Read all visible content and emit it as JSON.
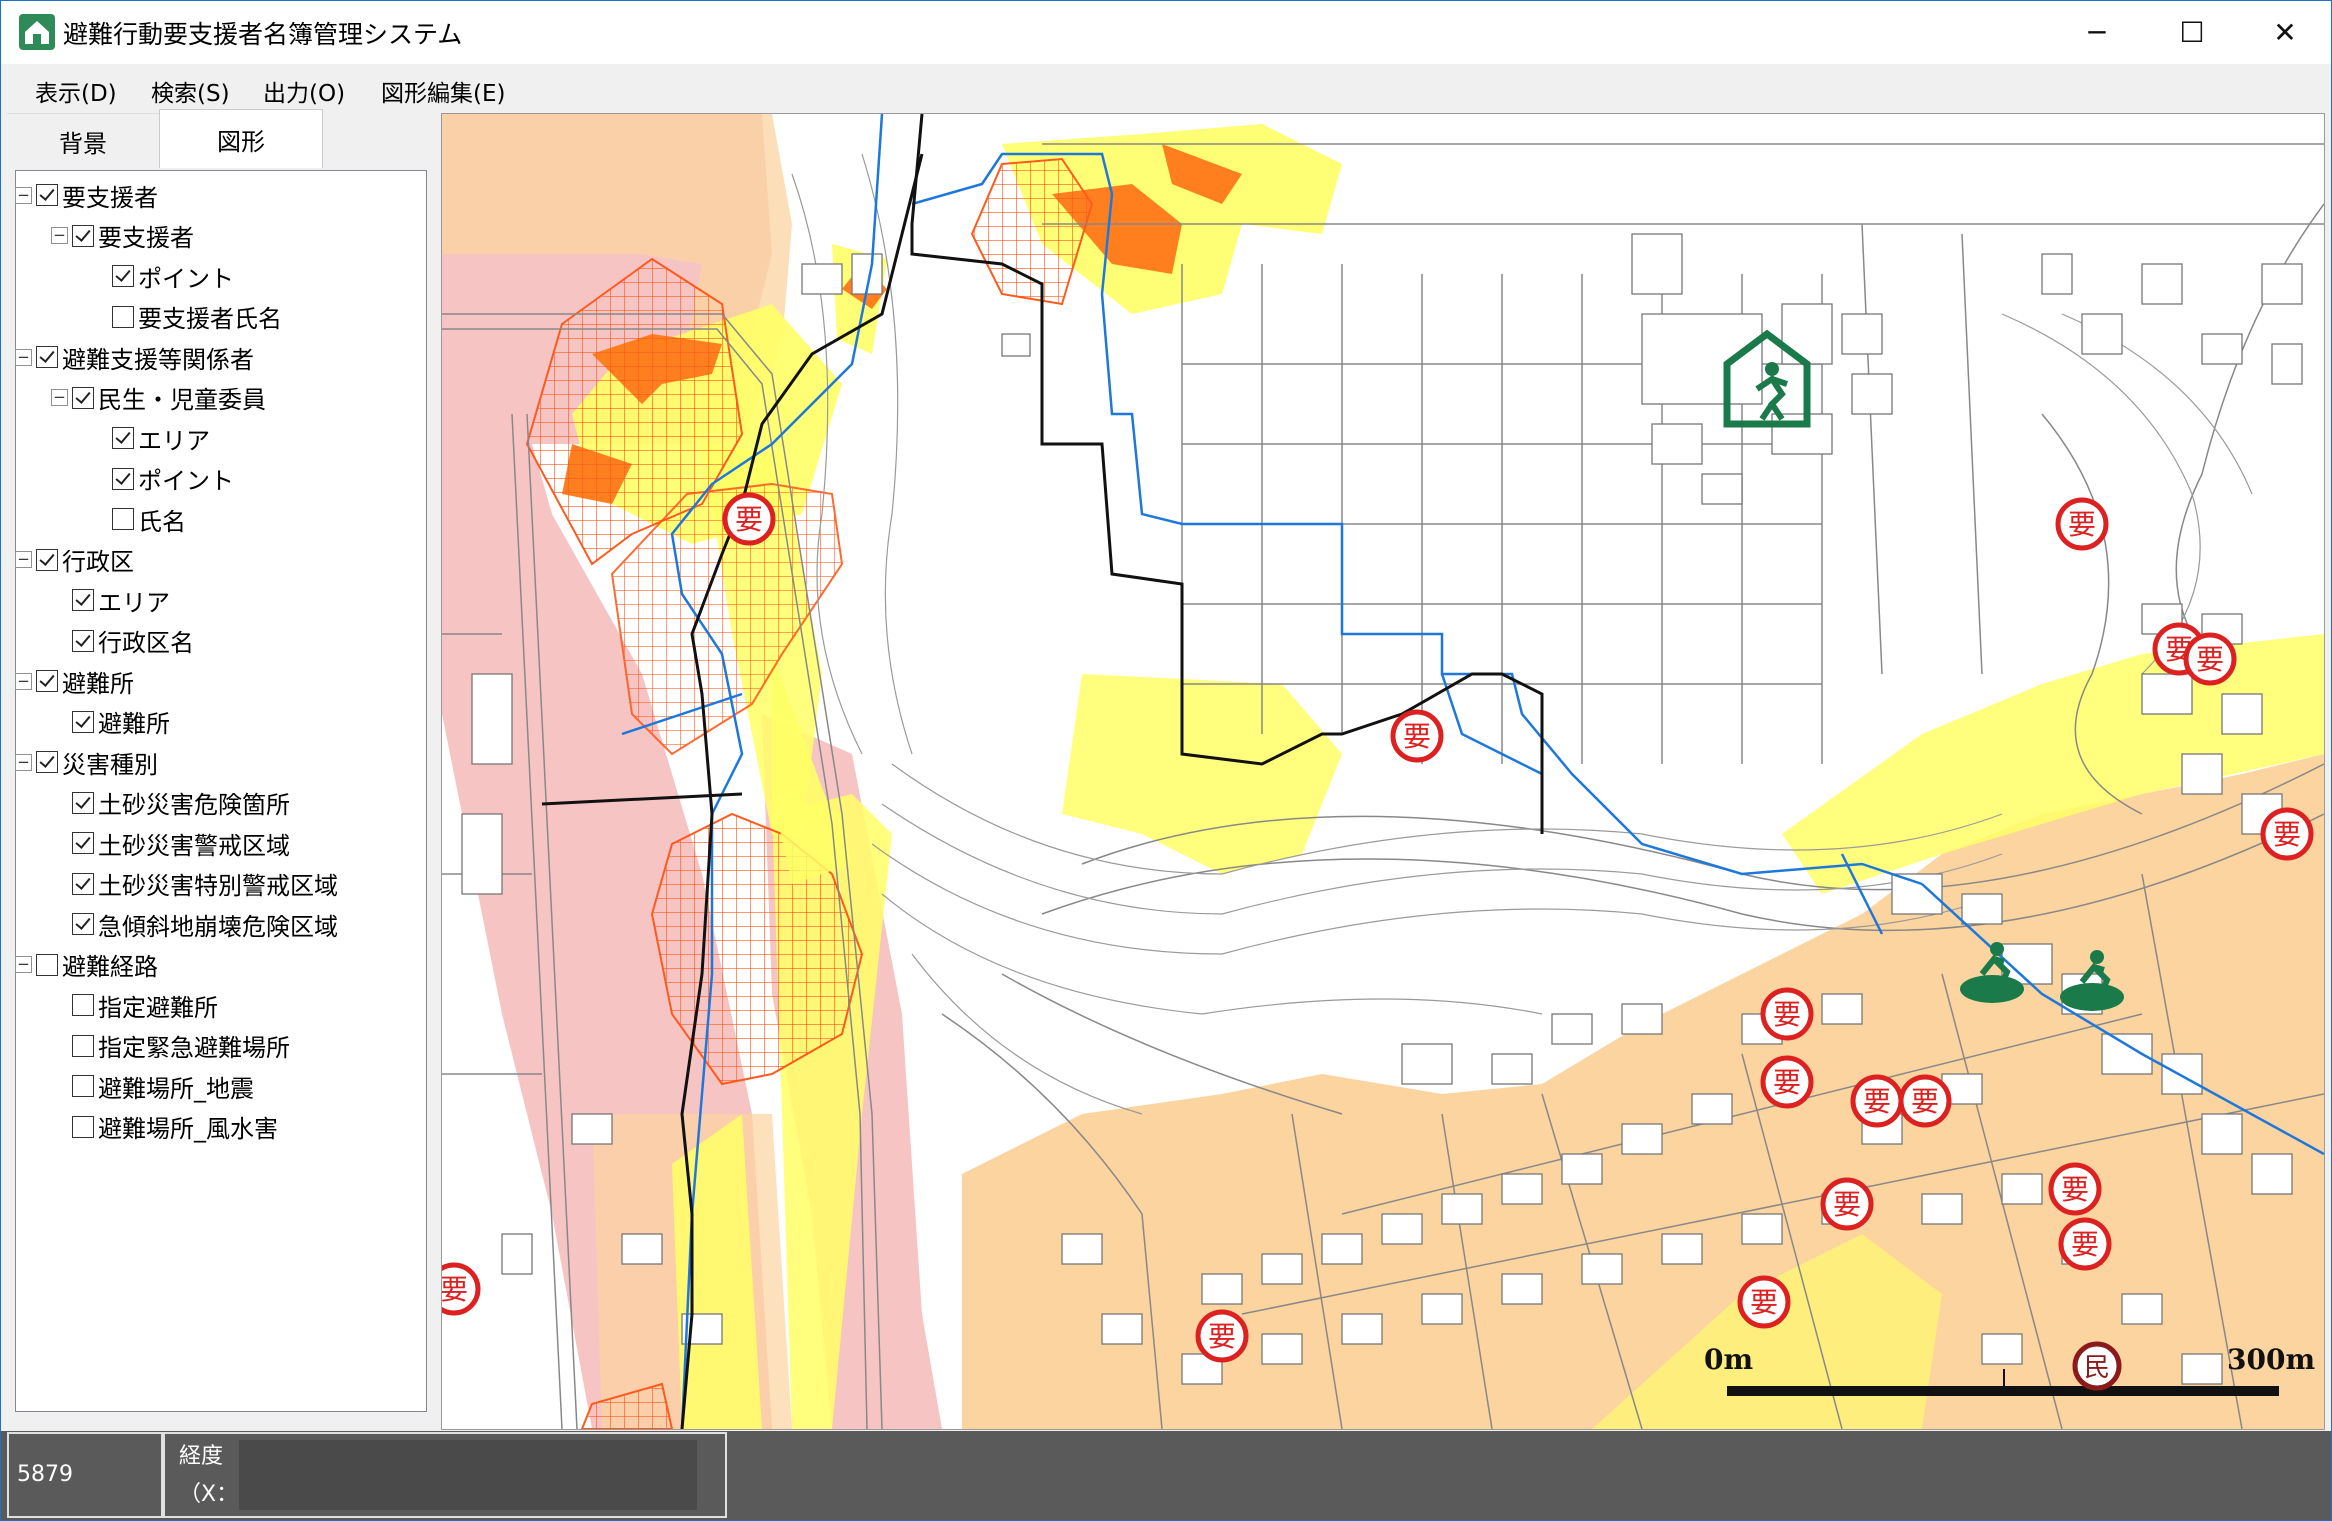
{
  "window": {
    "title": "避難行動要支援者名簿管理システム",
    "minimize_glyph": "─",
    "maximize_glyph": "☐",
    "close_glyph": "✕"
  },
  "menu": [
    {
      "label": "表示(D)"
    },
    {
      "label": "検索(S)"
    },
    {
      "label": "出力(O)"
    },
    {
      "label": "図形編集(E)"
    }
  ],
  "tabs": [
    {
      "label": "背景",
      "active": false
    },
    {
      "label": "図形",
      "active": true
    }
  ],
  "layer_tree": [
    {
      "label": "要支援者",
      "level": 0,
      "checked": true,
      "expander": "−"
    },
    {
      "label": "要支援者",
      "level": 1,
      "checked": true,
      "expander": "−"
    },
    {
      "label": "ポイント",
      "level": 2,
      "checked": true
    },
    {
      "label": "要支援者氏名",
      "level": 2,
      "checked": false
    },
    {
      "label": "避難支援等関係者",
      "level": 0,
      "checked": true,
      "expander": "−"
    },
    {
      "label": "民生・児童委員",
      "level": 1,
      "checked": true,
      "expander": "−"
    },
    {
      "label": "エリア",
      "level": 2,
      "checked": true
    },
    {
      "label": "ポイント",
      "level": 2,
      "checked": true
    },
    {
      "label": "氏名",
      "level": 2,
      "checked": false
    },
    {
      "label": "行政区",
      "level": 0,
      "checked": true,
      "expander": "−"
    },
    {
      "label": "エリア",
      "level": 1,
      "checked": true
    },
    {
      "label": "行政区名",
      "level": 1,
      "checked": true
    },
    {
      "label": "避難所",
      "level": 0,
      "checked": true,
      "expander": "−"
    },
    {
      "label": "避難所",
      "level": 1,
      "checked": true
    },
    {
      "label": "災害種別",
      "level": 0,
      "checked": true,
      "expander": "−"
    },
    {
      "label": "土砂災害危険箇所",
      "level": 1,
      "checked": true
    },
    {
      "label": "土砂災害警戒区域",
      "level": 1,
      "checked": true
    },
    {
      "label": "土砂災害特別警戒区域",
      "level": 1,
      "checked": true
    },
    {
      "label": "急傾斜地崩壊危険区域",
      "level": 1,
      "checked": true
    },
    {
      "label": "避難経路",
      "level": 0,
      "checked": false,
      "expander": "−"
    },
    {
      "label": "指定避難所",
      "level": 1,
      "checked": false
    },
    {
      "label": "指定緊急避難場所",
      "level": 1,
      "checked": false
    },
    {
      "label": "避難場所_地震",
      "level": 1,
      "checked": false
    },
    {
      "label": "避難場所_風水害",
      "level": 1,
      "checked": false
    }
  ],
  "map": {
    "marker_label": "要",
    "minsei_label": "民",
    "scale_start": "0m",
    "scale_end": "300m",
    "colors": {
      "sediment_zone": "#ffff66",
      "special_zone": "#ff7f1e",
      "steep_slope": "#f7c4c4",
      "warning_bg": "#fbd4a0",
      "route_blue": "#1e78dc",
      "boundary": "#111111",
      "marker_red": "#dd2020",
      "shelter_green": "#1a7a4a"
    }
  },
  "status": {
    "field1": "5879",
    "lon_label": "経度",
    "x_label": "（X："
  }
}
